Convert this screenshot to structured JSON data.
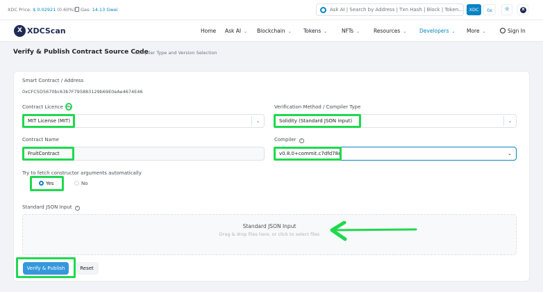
{
  "topbar": {
    "price_label": "XDC Price:",
    "price_value": "$ 0.02921",
    "price_change": "(0.60%)",
    "gas_label": "Gas:",
    "gas_value": "14.13 Gwei",
    "search_placeholder": "Ask AI | Search by Address | Txn Hash | Block | Token...",
    "btn_xdc": "XDC",
    "btn_0x": "0x",
    "btn_x": "X"
  },
  "nav": {
    "logo_mark": "X",
    "logo_text": "XDCScan",
    "items": [
      "Home",
      "Ask AI",
      "Blockchain",
      "Tokens",
      "NFTs",
      "Resources",
      "Developers",
      "More"
    ],
    "sign_in": "Sign In"
  },
  "page": {
    "title": "Verify & Publish Contract Source Code",
    "subtitle": "Compiler Type and Version Selection"
  },
  "form": {
    "address_label": "Smart Contract / Address",
    "address_value": "0xCFC5D5670bc63b7F795883129b69E0eAe4674E46",
    "licence_label": "Contract Licence",
    "licence_value": "MIT License (MIT)",
    "method_label": "Verification Method / Compiler Type",
    "method_value": "Solidity (Standard JSON input)",
    "name_label": "Contract Name",
    "name_value": "FruitContract",
    "compiler_label": "Compiler",
    "compiler_value": "v0.8.0+commit.c7dfd78e",
    "fetch_label": "Try to fetch constructor arguments automatically",
    "radio_yes": "Yes",
    "radio_no": "No",
    "radio_selected": "Yes",
    "json_label": "Standard JSON Input",
    "dropzone_title": "Standard JSON Input",
    "dropzone_hint": "Drag & drop files here, or click to select files",
    "verify_button": "Verify & Publish",
    "reset_button": "Reset"
  },
  "colors": {
    "accent": "#0784c3",
    "highlight": "#1ed94e",
    "navy": "#1f2a55"
  }
}
